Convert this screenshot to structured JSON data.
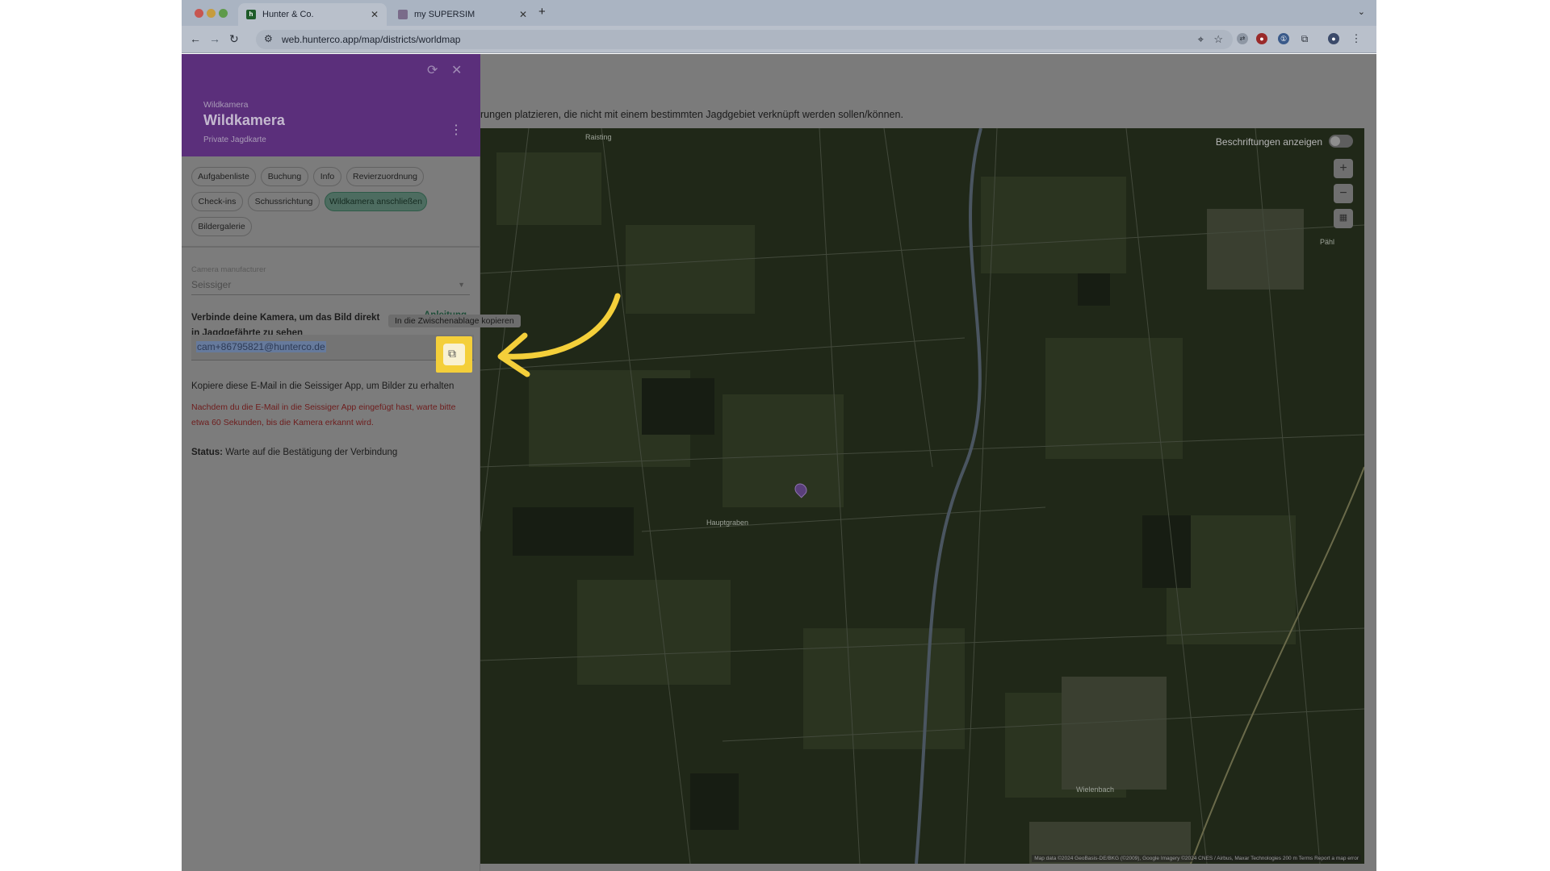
{
  "browser": {
    "tabs": [
      {
        "title": "Hunter & Co.",
        "active": true,
        "favicon": "hunterco-favicon"
      },
      {
        "title": "my SUPERSIM",
        "active": false,
        "favicon": "supersim-favicon"
      }
    ],
    "url": "web.hunterco.app/map/districts/worldmap",
    "new_tab_symbol": "+",
    "close_symbol": "✕"
  },
  "page": {
    "intro_text": "rungen platzieren, die nicht mit einem bestimmten Jagdgebiet verknüpft werden sollen/können."
  },
  "panel": {
    "category": "Wildkamera",
    "title": "Wildkamera",
    "subtitle": "Private Jagdkarte",
    "chips": [
      {
        "label": "Aufgabenliste",
        "selected": false
      },
      {
        "label": "Buchung",
        "selected": false
      },
      {
        "label": "Info",
        "selected": false
      },
      {
        "label": "Revierzuordnung",
        "selected": false
      },
      {
        "label": "Check-ins",
        "selected": false
      },
      {
        "label": "Schussrichtung",
        "selected": false
      },
      {
        "label": "Wildkamera anschließen",
        "selected": true
      },
      {
        "label": "Bildergalerie",
        "selected": false
      }
    ],
    "manufacturer": {
      "label": "Camera manufacturer",
      "value": "Seissiger"
    },
    "connect_text": "Verbinde deine Kamera, um das Bild direkt in Jagdgefährte zu sehen",
    "guide_link": "Anleitung",
    "tooltip": "In die Zwischenablage kopieren",
    "email": "cam+86795821@hunterco.de",
    "copy_hint": "Kopiere diese E-Mail in die Seissiger App, um Bilder zu erhalten",
    "warning": "Nachdem du die E-Mail in die Seissiger App eingefügt hast, warte bitte etwa 60 Sekunden, bis die Kamera erkannt wird.",
    "status_label": "Status:",
    "status_value": "Warte auf die Bestätigung der Verbindung"
  },
  "map": {
    "labels_toggle": "Beschriftungen anzeigen",
    "zoom_in": "+",
    "zoom_out": "−",
    "attribution": "Map data ©2024 GeoBasis-DE/BKG (©2009), Google Imagery ©2024 CNES / Airbus, Maxar Technologies    200 m    Terms    Report a map error",
    "places": [
      "Raisting",
      "Pähl",
      "Wielenbach",
      "Hauptgraben"
    ]
  },
  "colors": {
    "panel_header": "#5b2f7b",
    "highlight": "#f4cf3a",
    "accent_green": "#1e4d38",
    "warning_red": "#6e1c1c"
  }
}
